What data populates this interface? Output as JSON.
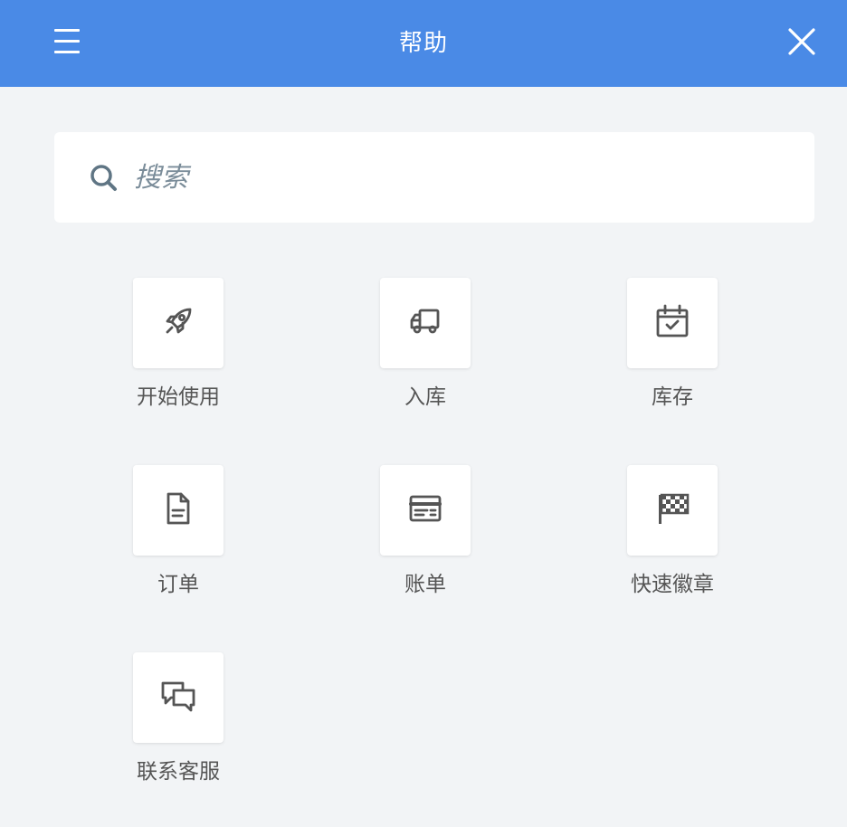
{
  "header": {
    "title": "帮助",
    "menu_icon": "hamburger-menu-icon",
    "close_icon": "close-icon",
    "background_color": "#4a8ae6"
  },
  "search": {
    "placeholder": "搜索",
    "icon": "search-icon"
  },
  "tiles": [
    {
      "label": "开始使用",
      "icon": "rocket-icon"
    },
    {
      "label": "入库",
      "icon": "truck-icon"
    },
    {
      "label": "库存",
      "icon": "calendar-check-icon"
    },
    {
      "label": "订单",
      "icon": "document-icon"
    },
    {
      "label": "账单",
      "icon": "bill-card-icon"
    },
    {
      "label": "快速徽章",
      "icon": "checkered-flag-icon"
    },
    {
      "label": "联系客服",
      "icon": "chat-bubbles-icon"
    }
  ],
  "colors": {
    "accent": "#4a8ae6",
    "background": "#f2f4f6",
    "icon": "#555555",
    "placeholder": "#7a8c99"
  }
}
